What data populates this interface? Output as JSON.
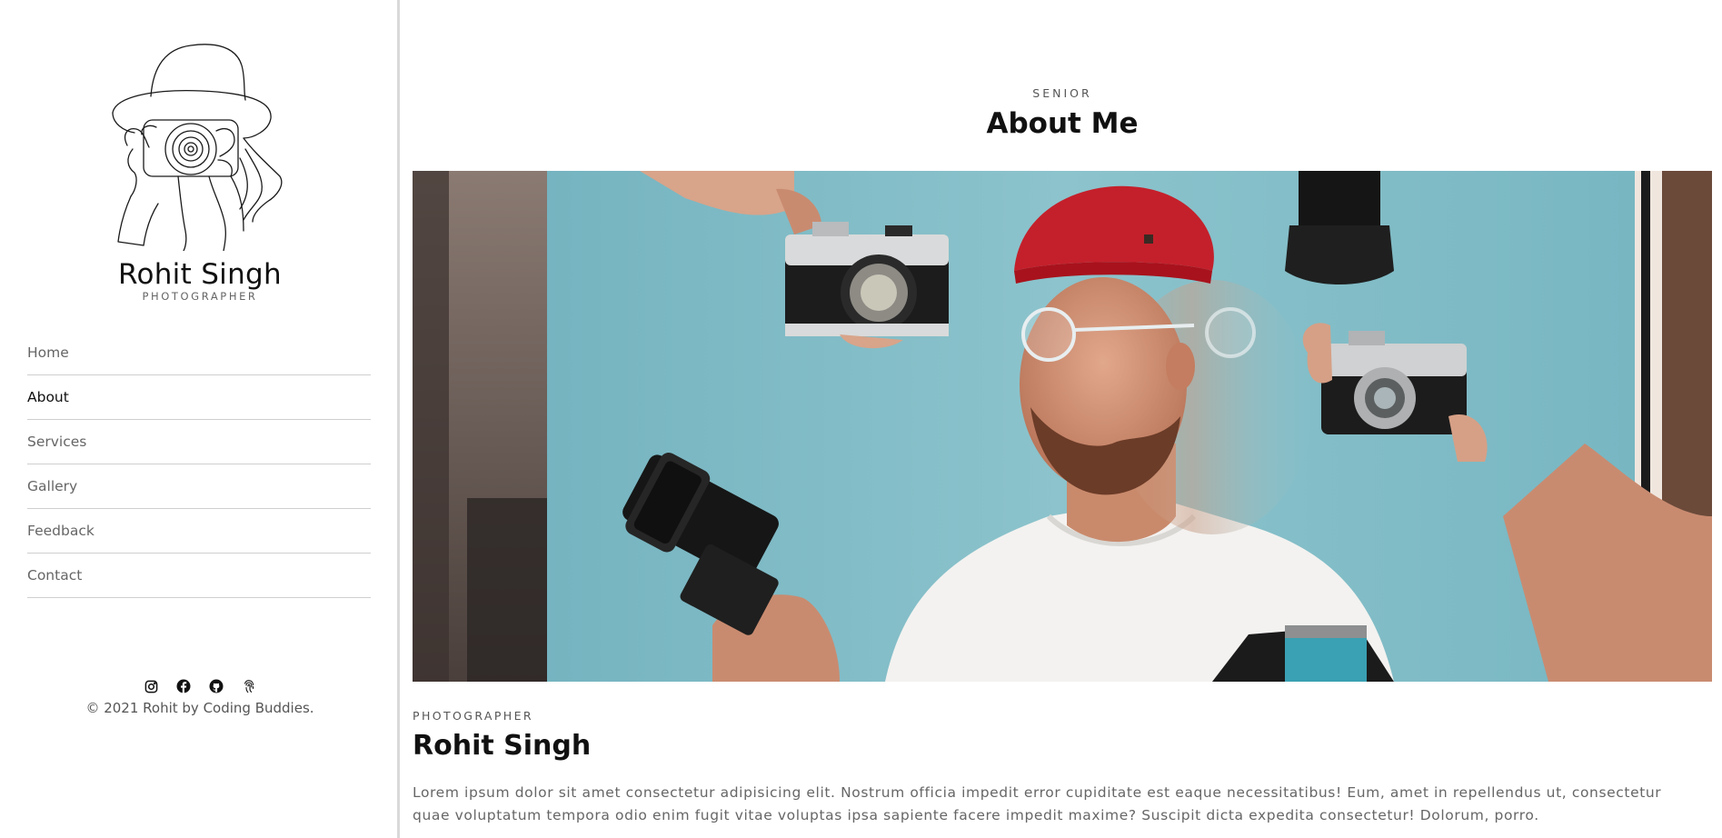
{
  "sidebar": {
    "brand_name": "Rohit Singh",
    "brand_role": "PHOTOGRAPHER",
    "nav": [
      {
        "label": "Home"
      },
      {
        "label": "About"
      },
      {
        "label": "Services"
      },
      {
        "label": "Gallery"
      },
      {
        "label": "Feedback"
      },
      {
        "label": "Contact"
      }
    ],
    "active_nav": "About",
    "social_icons": [
      "instagram-icon",
      "facebook-icon",
      "github-icon",
      "fingerprint-icon"
    ],
    "copyright": "© 2021 Rohit by Coding Buddies."
  },
  "main": {
    "eyebrow": "SENIOR",
    "title": "About Me",
    "role_label": "PHOTOGRAPHER",
    "person_name": "Rohit Singh",
    "bio": "Lorem ipsum dolor sit amet consectetur adipisicing elit. Nostrum officia impedit error cupiditate est eaque necessitatibus! Eum, amet in repellendus ut, consectetur quae voluptatum tempora odio enim fugit vitae voluptas ipsa sapiente facere impedit maxime? Suscipit dicta expedita consectetur! Dolorum, porro."
  },
  "colors": {
    "background": "#ffffff",
    "divider": "#d9d9d9",
    "nav_text": "#666666",
    "nav_active": "#111111",
    "photo_backdrop": "#7fb9c4",
    "beanie": "#c4202b"
  }
}
